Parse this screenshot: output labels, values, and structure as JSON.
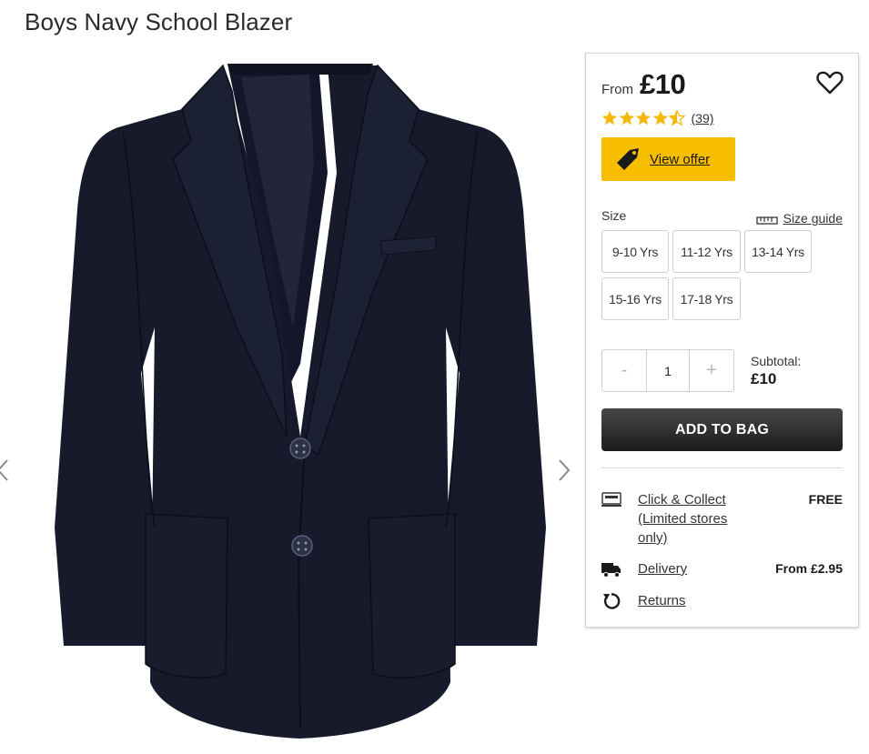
{
  "product": {
    "title": "Boys Navy School Blazer"
  },
  "gallery": {
    "prev_icon": "chevron-left-icon",
    "next_icon": "chevron-right-icon"
  },
  "panel": {
    "price_prefix": "From",
    "price": "£10",
    "wishlist_icon": "heart-icon",
    "rating": {
      "stars": 4.5,
      "max": 5,
      "count": "(39)",
      "star_color": "#f5b800"
    },
    "offer": {
      "icon": "tag-icon",
      "label": "View offer",
      "color": "#f7be00"
    },
    "size": {
      "label": "Size",
      "guide_icon": "ruler-icon",
      "guide_label": "Size guide",
      "options": [
        "9-10 Yrs",
        "11-12 Yrs",
        "13-14 Yrs",
        "15-16 Yrs",
        "17-18 Yrs"
      ]
    },
    "quantity": {
      "minus": "-",
      "value": "1",
      "plus": "+"
    },
    "subtotal": {
      "label": "Subtotal:",
      "value": "£10"
    },
    "add_to_bag": "ADD TO BAG",
    "delivery": [
      {
        "icon": "click-collect-icon",
        "label": "Click & Collect (Limited stores only)",
        "price": "FREE"
      },
      {
        "icon": "delivery-truck-icon",
        "label": "Delivery",
        "price": "From £2.95"
      },
      {
        "icon": "returns-icon",
        "label": "Returns",
        "price": ""
      }
    ]
  }
}
